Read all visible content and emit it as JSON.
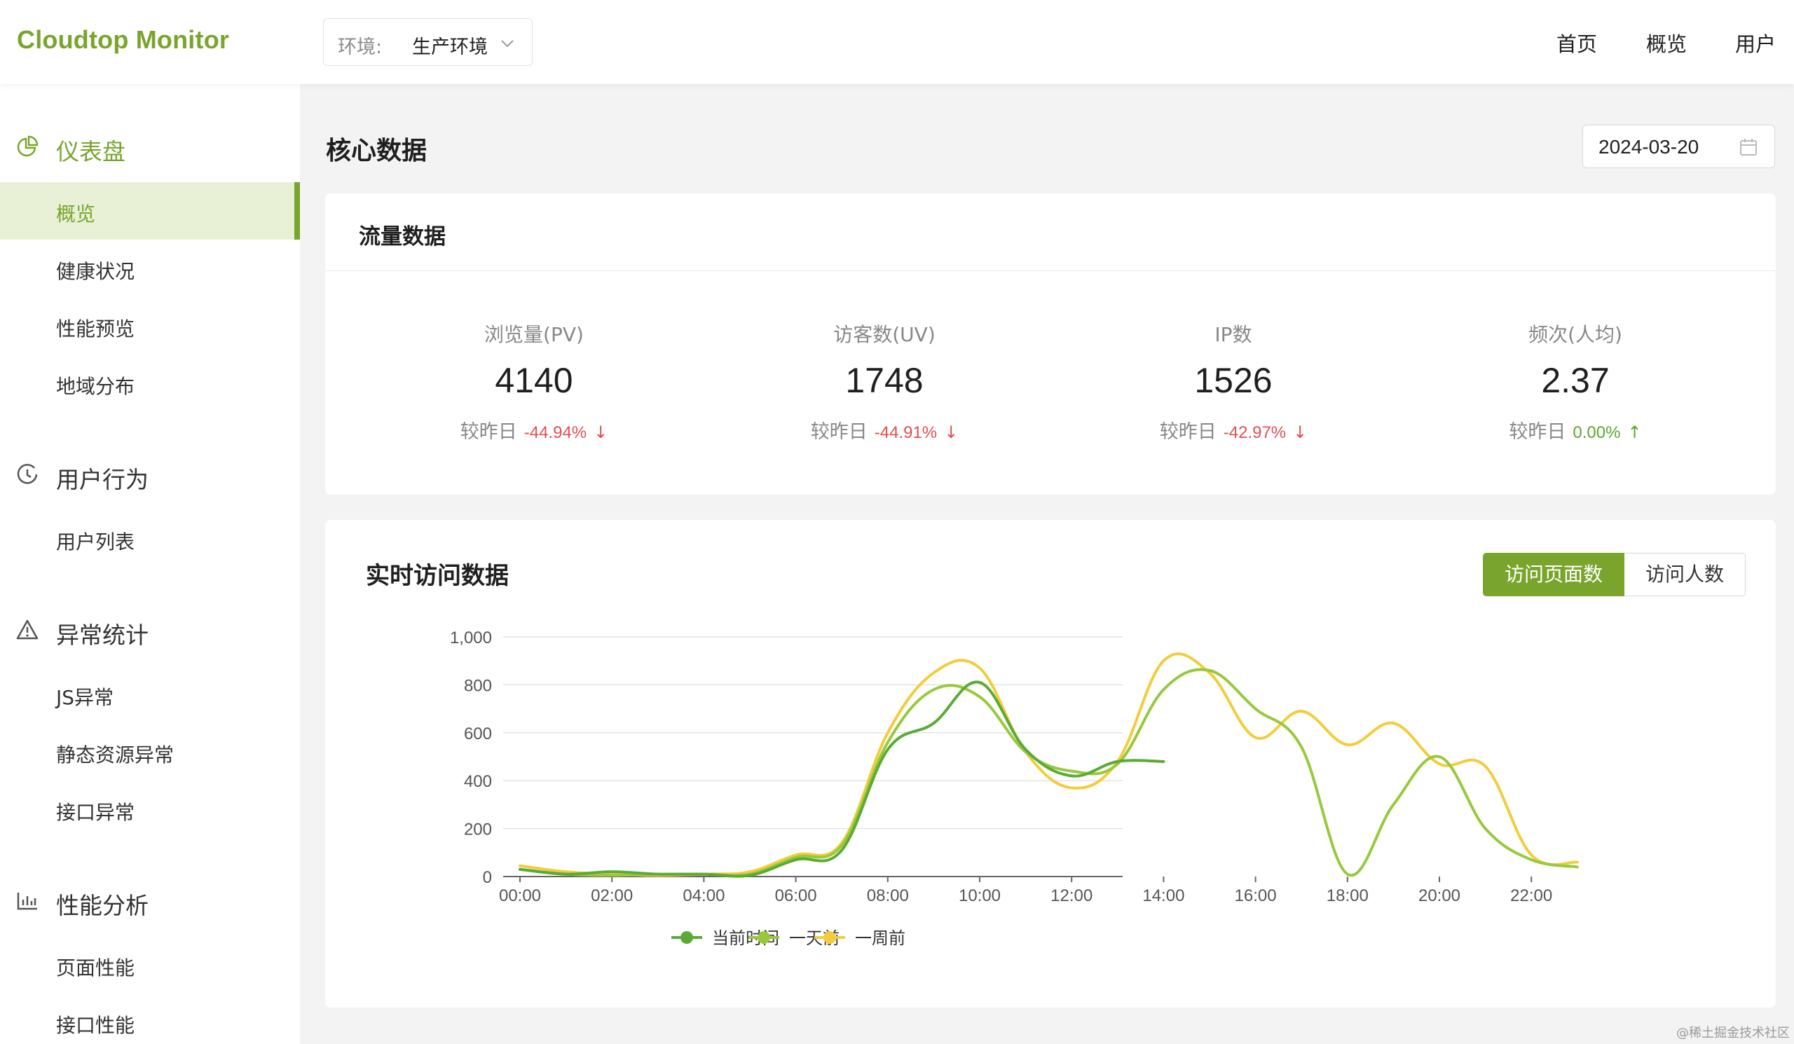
{
  "header": {
    "logo": "Cloudtop Monitor",
    "env_label": "环境:",
    "env_value": "生产环境",
    "nav": [
      "首页",
      "概览",
      "用户"
    ]
  },
  "sidebar": {
    "groups": [
      {
        "title": "仪表盘",
        "icon": "pie-chart-icon",
        "items": [
          "概览",
          "健康状况",
          "性能预览",
          "地域分布"
        ]
      },
      {
        "title": "用户行为",
        "icon": "clock-icon",
        "items": [
          "用户列表"
        ]
      },
      {
        "title": "异常统计",
        "icon": "warning-icon",
        "items": [
          "JS异常",
          "静态资源异常",
          "接口异常"
        ]
      },
      {
        "title": "性能分析",
        "icon": "bar-chart-icon",
        "items": [
          "页面性能",
          "接口性能"
        ]
      }
    ]
  },
  "main": {
    "section_title": "核心数据",
    "date": "2024-03-20",
    "flow_card": {
      "title": "流量数据",
      "compare_label": "较昨日",
      "metrics": [
        {
          "label": "浏览量(PV)",
          "value": "4140",
          "change": "-44.94%",
          "direction": "down"
        },
        {
          "label": "访客数(UV)",
          "value": "1748",
          "change": "-44.91%",
          "direction": "down"
        },
        {
          "label": "IP数",
          "value": "1526",
          "change": "-42.97%",
          "direction": "down"
        },
        {
          "label": "频次(人均)",
          "value": "2.37",
          "change": "0.00%",
          "direction": "up"
        }
      ]
    },
    "realtime_card": {
      "title": "实时访问数据",
      "tabs": [
        "访问页面数",
        "访问人数"
      ],
      "active_tab": 0
    }
  },
  "chart_data": {
    "type": "line",
    "x": [
      "00:00",
      "01:00",
      "02:00",
      "03:00",
      "04:00",
      "05:00",
      "06:00",
      "07:00",
      "08:00",
      "09:00",
      "10:00",
      "11:00",
      "12:00",
      "13:00",
      "14:00",
      "15:00",
      "16:00",
      "17:00",
      "18:00",
      "19:00",
      "20:00",
      "21:00",
      "22:00",
      "23:00"
    ],
    "xticks": [
      "00:00",
      "02:00",
      "04:00",
      "06:00",
      "08:00",
      "10:00",
      "12:00",
      "14:00",
      "16:00",
      "18:00",
      "20:00",
      "22:00"
    ],
    "yticks": [
      "0",
      "200",
      "400",
      "600",
      "800",
      "1,000"
    ],
    "ylim": [
      0,
      1000
    ],
    "series": [
      {
        "name": "当前时间",
        "color": "#5aab35",
        "values": [
          30,
          10,
          20,
          10,
          10,
          5,
          70,
          110,
          530,
          640,
          810,
          530,
          420,
          480,
          480
        ]
      },
      {
        "name": "一天前",
        "color": "#98c93c",
        "values": [
          30,
          10,
          5,
          10,
          10,
          10,
          80,
          130,
          560,
          780,
          750,
          520,
          440,
          470,
          780,
          860,
          700,
          540,
          10,
          300,
          500,
          200,
          70,
          40
        ]
      },
      {
        "name": "一周前",
        "color": "#f2cd3b",
        "values": [
          45,
          20,
          10,
          5,
          10,
          20,
          90,
          140,
          600,
          850,
          870,
          520,
          370,
          480,
          900,
          850,
          580,
          690,
          550,
          640,
          470,
          460,
          90,
          60
        ]
      }
    ],
    "legend_position": "bottom-center",
    "grid": true
  },
  "watermark": "@稀土掘金技术社区",
  "colors": {
    "accent": "#7aa52c",
    "down": "#e0504f",
    "up": "#5aa72c"
  }
}
